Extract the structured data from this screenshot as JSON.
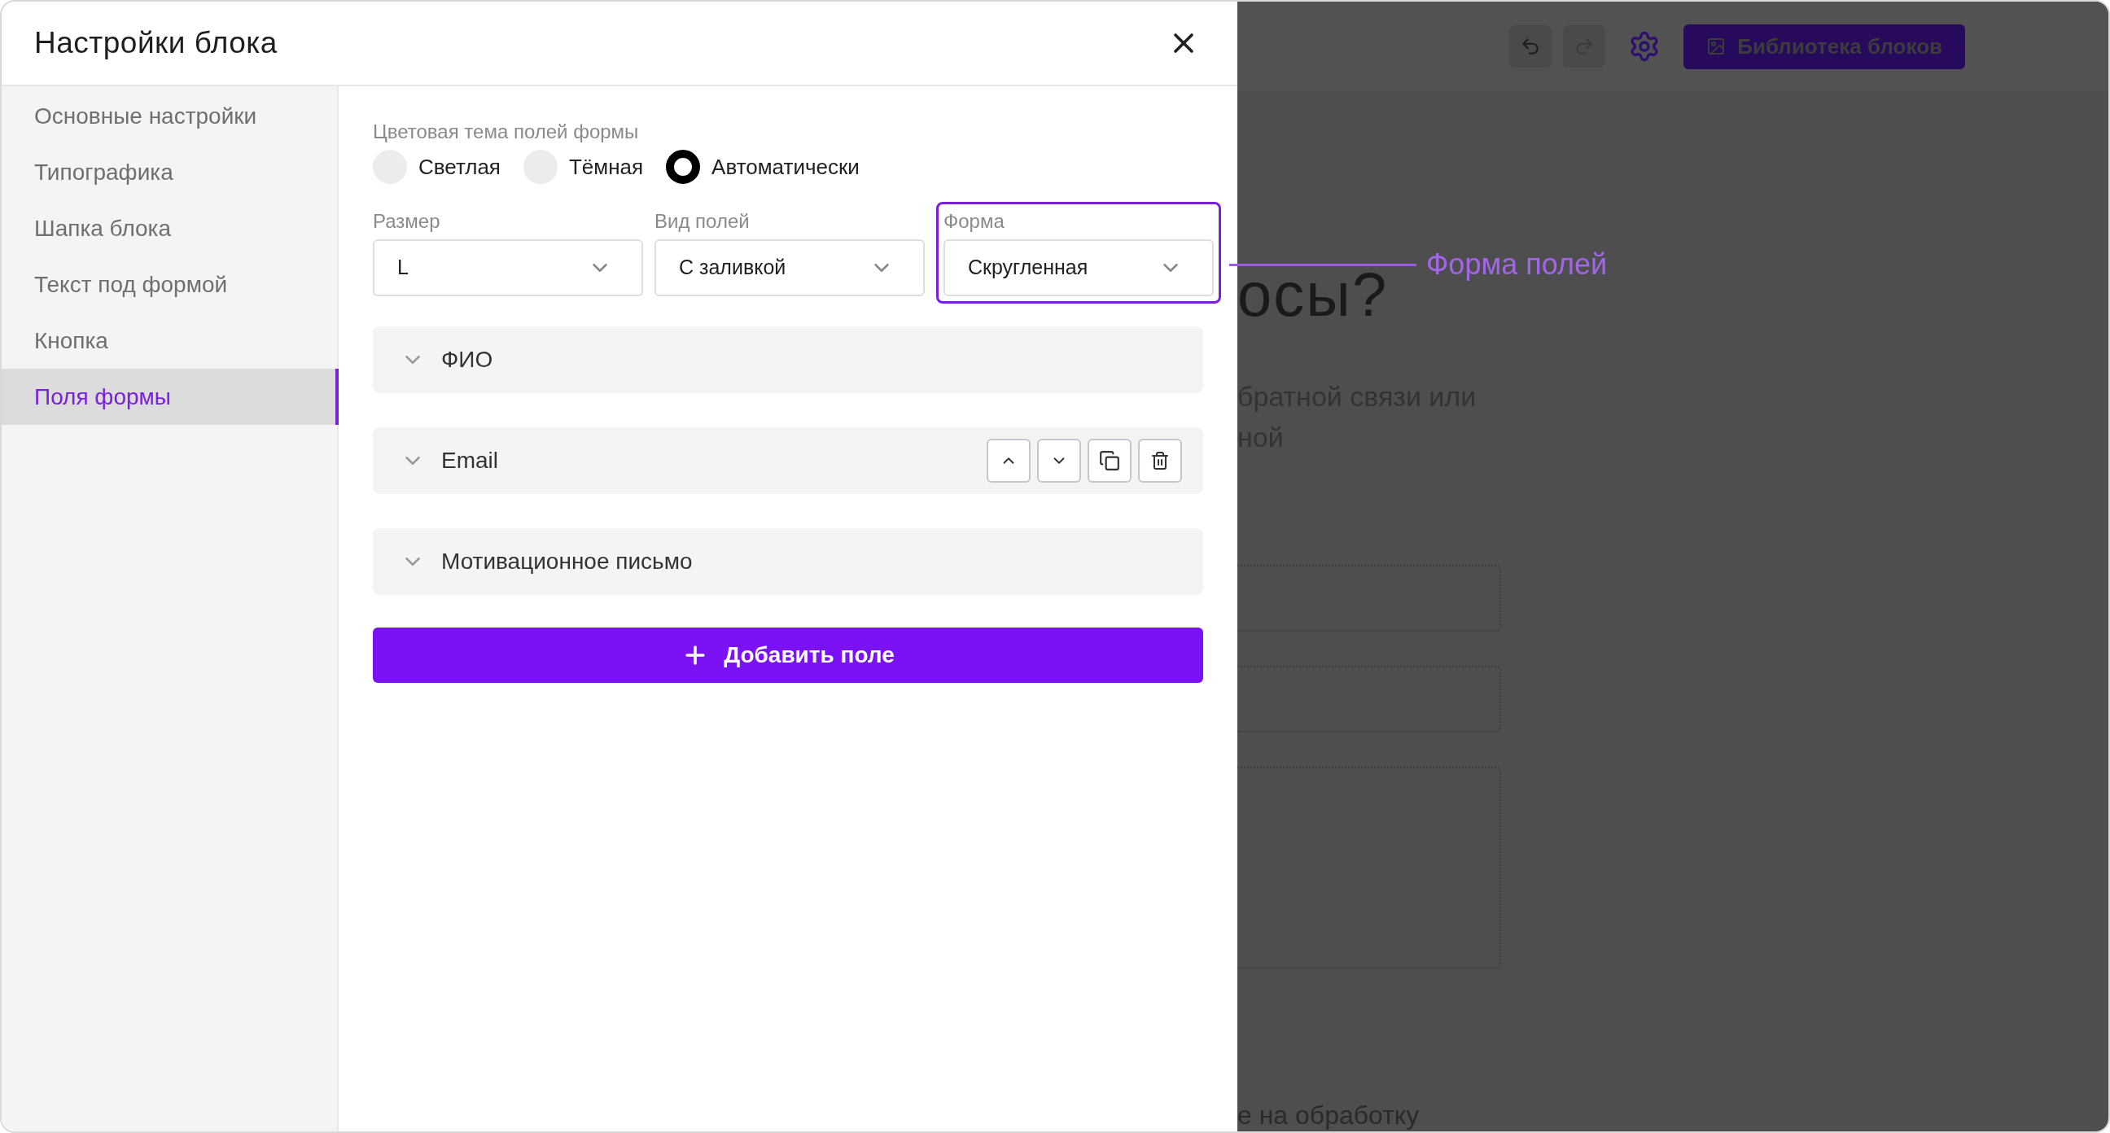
{
  "dialog": {
    "title": "Настройки блока",
    "sidebar": [
      {
        "label": "Основные настройки",
        "selected": false
      },
      {
        "label": "Типографика",
        "selected": false
      },
      {
        "label": "Шапка блока",
        "selected": false
      },
      {
        "label": "Текст под формой",
        "selected": false
      },
      {
        "label": "Кнопка",
        "selected": false
      },
      {
        "label": "Поля формы",
        "selected": true
      }
    ],
    "color_theme": {
      "label": "Цветовая тема полей формы",
      "options": [
        {
          "label": "Светлая",
          "selected": false
        },
        {
          "label": "Тёмная",
          "selected": false
        },
        {
          "label": "Автоматически",
          "selected": true
        }
      ]
    },
    "selects": [
      {
        "label": "Размер",
        "value": "L",
        "highlighted": false
      },
      {
        "label": "Вид полей",
        "value": "С заливкой",
        "highlighted": false
      },
      {
        "label": "Форма",
        "value": "Скругленная",
        "highlighted": true
      }
    ],
    "fields": [
      {
        "label": "ФИО",
        "show_actions": false
      },
      {
        "label": "Email",
        "show_actions": true
      },
      {
        "label": "Мотивационное письмо",
        "show_actions": false
      }
    ],
    "add_button": "Добавить поле"
  },
  "annotation": {
    "text": "Форма полей"
  },
  "background": {
    "library_button": "Библиотека блоков",
    "heading": "осы?",
    "paragraph_lines": [
      "братной связи или",
      "ной"
    ],
    "footer_text": "е на обработку"
  }
}
